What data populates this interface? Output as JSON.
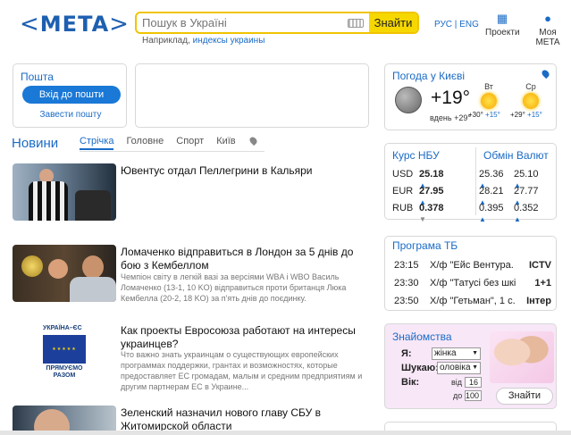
{
  "header": {
    "logo": "META",
    "search": {
      "placeholder": "Пошук в Україні",
      "button": "Знайти"
    },
    "hint": {
      "prefix": "Наприклад, ",
      "example": "индексы украины"
    },
    "lang": "РУС | ENG",
    "projects": "Проекти",
    "account": "Моя META"
  },
  "mail": {
    "title": "Пошта",
    "login": "Вхід до пошти",
    "register": "Завести пошту"
  },
  "news": {
    "title": "Новини",
    "tabs": [
      "Стрічка",
      "Головне",
      "Спорт",
      "Київ"
    ],
    "items": [
      {
        "headline": "Ювентус отдал Пеллегрини в Кальяри",
        "desc": ""
      },
      {
        "headline": "Ломаченко відправиться в Лондон за 5 днів до бою з Кембеллом",
        "desc": "Чемпіон світу в легкій вазі за версіями WBA і WBO Василь Ломаченко (13-1, 10 KO) відправиться проти британця Люка Кембелла (20-2, 18 KO) за п'ять днів до поєдинку."
      },
      {
        "headline": "Как проекты Евросоюза работают на интересы украинцев?",
        "desc": "Что важно знать украинцам о существующих европейских программах поддержки, грантах и возможностях, которые предоставляет ЕС громадам, малым и средним предприятиям и другим партнерам ЕС в Украине...",
        "logo_top": "УКРАЇНА–ЄС",
        "logo_bottom": "ПРЯМУЄМО РАЗОМ"
      },
      {
        "headline": "Зеленский назначил нового главу СБУ в Житомирской области",
        "desc": ""
      }
    ]
  },
  "weather": {
    "title": "Погода у Києві",
    "temp": "+19°",
    "day_label": "вдень",
    "day_temp": "+29°",
    "forecast": [
      {
        "day": "Вт",
        "hi": "+30°",
        "lo": "+15°"
      },
      {
        "day": "Ср",
        "hi": "+29°",
        "lo": "+15°"
      }
    ]
  },
  "currency": {
    "nbu_title": "Курс НБУ",
    "exchange_title": "Обмін Валют",
    "rows": [
      {
        "code": "USD",
        "nbu": "25.18",
        "buy": "25.36",
        "sell": "25.10"
      },
      {
        "code": "EUR",
        "nbu": "27.95",
        "buy": "28.21",
        "sell": "27.77"
      },
      {
        "code": "RUB",
        "nbu": "0.378",
        "buy": "0.395",
        "sell": "0.352"
      }
    ]
  },
  "tv": {
    "title": "Програма ТБ",
    "rows": [
      {
        "time": "23:15",
        "show": "Х/ф \"Ейс Вентура. Де...",
        "channel": "ICTV"
      },
      {
        "time": "23:30",
        "show": "Х/ф \"Татусі без шкідл...",
        "channel": "1+1"
      },
      {
        "time": "23:50",
        "show": "Х/ф \"Гетьман\", 1 с.",
        "channel": "Інтер"
      }
    ]
  },
  "dating": {
    "title": "Знайомства",
    "me_label": "Я:",
    "me_value": "жінка",
    "seek_label": "Шукаю:",
    "seek_value": "оловіка",
    "age_label": "Вік:",
    "from_label": "від",
    "from_value": "16",
    "to_label": "до",
    "to_value": "100",
    "button": "Знайти"
  },
  "colors": {
    "accent": "#1a6bc6",
    "search_border": "#f0c400",
    "search_button": "#f6d800",
    "dating_bg": "#f7e7f7"
  }
}
